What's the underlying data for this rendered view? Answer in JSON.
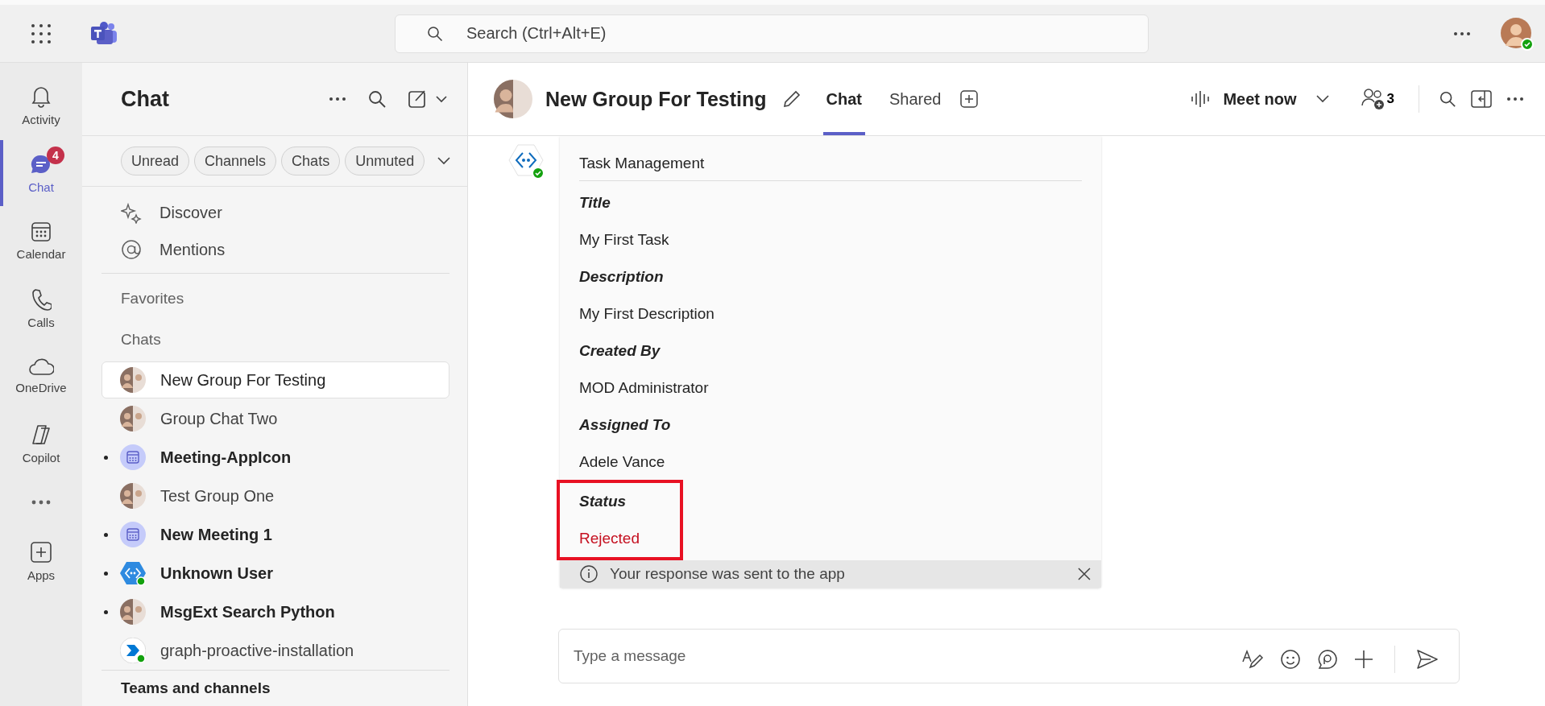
{
  "top_bar": {
    "search": {
      "placeholder": "Search (Ctrl+Alt+E)"
    }
  },
  "rail": [
    {
      "label": "Activity",
      "kind": "bell",
      "selected": false
    },
    {
      "label": "Chat",
      "kind": "chat",
      "selected": true,
      "badge": "4"
    },
    {
      "label": "Calendar",
      "kind": "calendar",
      "selected": false
    },
    {
      "label": "Calls",
      "kind": "phone",
      "selected": false
    },
    {
      "label": "OneDrive",
      "kind": "cloud",
      "selected": false
    },
    {
      "label": "Copilot",
      "kind": "copilot",
      "selected": false
    },
    {
      "kind": "more",
      "selected": false
    },
    {
      "label": "Apps",
      "kind": "apps",
      "selected": false
    }
  ],
  "chat_panel": {
    "title": "Chat",
    "filters": [
      {
        "label": "Unread"
      },
      {
        "label": "Channels"
      },
      {
        "label": "Chats"
      },
      {
        "label": "Unmuted"
      }
    ],
    "quick_links": [
      {
        "label": "Discover",
        "kind": "sparkle"
      },
      {
        "label": "Mentions",
        "kind": "at"
      }
    ],
    "favorites_heading": "Favorites",
    "chats_heading": "Chats",
    "chats": [
      {
        "name": "New Group For Testing",
        "kind": "group",
        "unread": false,
        "selected": true
      },
      {
        "name": "Group Chat Two",
        "kind": "group",
        "unread": false,
        "selected": false
      },
      {
        "name": "Meeting-AppIcon",
        "kind": "meeting",
        "unread": true,
        "selected": false
      },
      {
        "name": "Test Group One",
        "kind": "group",
        "unread": false,
        "selected": false
      },
      {
        "name": "New Meeting 1",
        "kind": "meeting",
        "unread": true,
        "selected": false
      },
      {
        "name": "Unknown User",
        "kind": "bot",
        "unread": true,
        "selected": false
      },
      {
        "name": "MsgExt Search Python",
        "kind": "group",
        "unread": true,
        "selected": false
      },
      {
        "name": "graph-proactive-installation",
        "kind": "app",
        "unread": false,
        "selected": false
      }
    ],
    "teams_heading": "Teams and channels"
  },
  "conversation": {
    "title": "New Group For Testing",
    "tabs": [
      {
        "label": "Chat",
        "selected": true
      },
      {
        "label": "Shared",
        "selected": false
      }
    ],
    "meet_now": "Meet now",
    "participants": "3",
    "card": {
      "title": "Task Management",
      "fields": [
        {
          "label": "Title",
          "value": "My First Task"
        },
        {
          "label": "Description",
          "value": "My First Description"
        },
        {
          "label": "Created By",
          "value": "MOD Administrator"
        },
        {
          "label": "Assigned To",
          "value": "Adele Vance"
        },
        {
          "label": "Status",
          "value": "Rejected",
          "color": "#c50f1f",
          "highlighted": true
        }
      ],
      "notice": "Your response was sent to the app"
    },
    "compose": {
      "placeholder": "Type a message"
    }
  }
}
